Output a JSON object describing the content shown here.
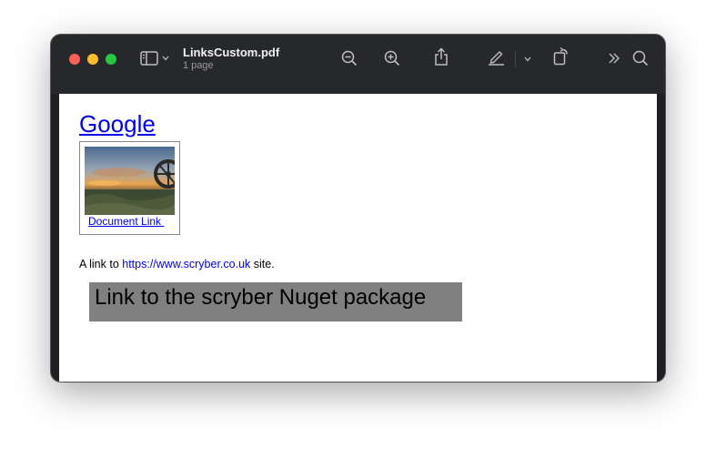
{
  "window": {
    "title": "LinksCustom.pdf",
    "subtitle": "1 page"
  },
  "toolbar": {
    "icons": [
      "sidebar-icon",
      "chevron-down-icon",
      "zoom-out-icon",
      "zoom-in-icon",
      "share-icon",
      "markup-pen-icon",
      "chevron-down-icon",
      "rotate-icon",
      "more-chevrons-icon",
      "search-icon"
    ]
  },
  "document": {
    "google_link": "Google",
    "image_link_label": "Document Link ",
    "paragraph_prefix": "A link to ",
    "paragraph_link": "https://www.scryber.co.uk",
    "paragraph_suffix": " site.",
    "nuget_link": "Link to the scryber Nuget package"
  },
  "colors": {
    "link": "#0000ee",
    "nuget_bg": "#808080",
    "titlebar": "#27282c"
  }
}
